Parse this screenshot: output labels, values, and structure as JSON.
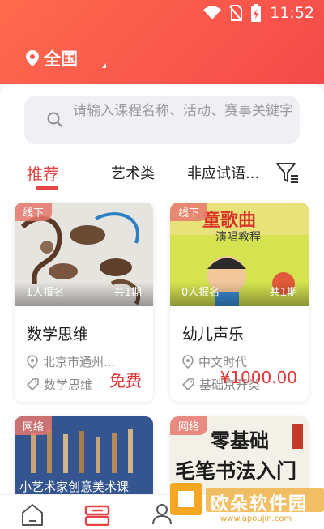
{
  "status_bar": {
    "time": "11:52"
  },
  "header": {
    "location": "全国"
  },
  "search": {
    "placeholder": "请输入课程名称、活动、赛事关键字"
  },
  "tabs": [
    {
      "label": "推荐",
      "active": true
    },
    {
      "label": "艺术类",
      "active": false
    },
    {
      "label": "非应试语...",
      "active": false
    }
  ],
  "cards": [
    {
      "badge": "线下",
      "enrolled": "1人报名",
      "periods": "共1期",
      "title": "数学思维",
      "address": "北京市通州...",
      "tag": "数学思维",
      "price": "免费"
    },
    {
      "badge": "线下",
      "enrolled": "0人报名",
      "periods": "共1期",
      "title": "幼儿声乐",
      "org": "中文时代",
      "tag": "基础京开类",
      "price": "¥1000.00",
      "image_text": [
        "童歌曲",
        "演唱教程"
      ]
    },
    {
      "badge": "网络",
      "image_text": [
        "小艺术家创意美术课"
      ]
    },
    {
      "badge": "网络",
      "image_text": [
        "零基础",
        "毛笔书法入门"
      ]
    }
  ],
  "watermark": {
    "text": "欧朵软件园",
    "sub": "www.apoujin.com"
  },
  "colors": {
    "accent": "#e64545",
    "header_start": "#ff6a4d",
    "header_end": "#f44a4a"
  }
}
